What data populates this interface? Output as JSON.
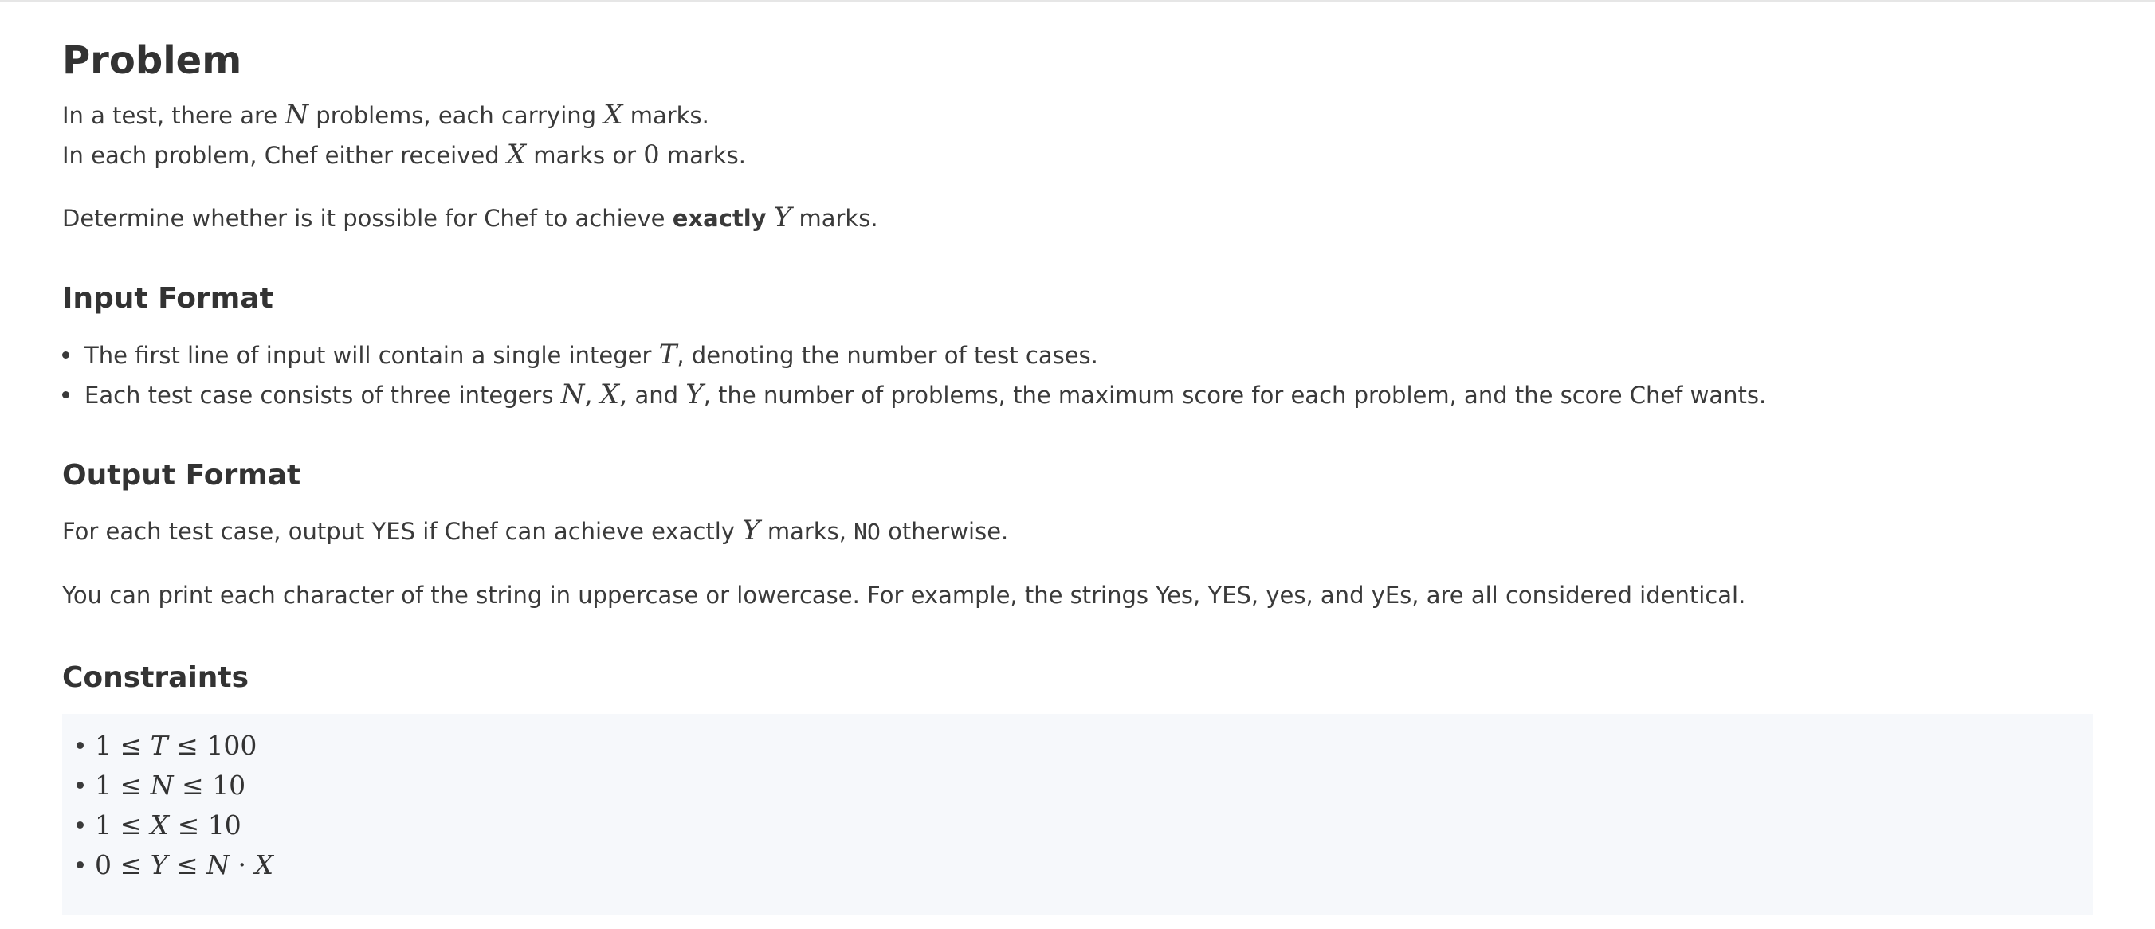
{
  "problem": {
    "title": "Problem",
    "l1_a": "In a test, there are ",
    "l1_var1": "N",
    "l1_b": " problems, each carrying ",
    "l1_var2": "X",
    "l1_c": " marks.",
    "l2_a": "In each problem, Chef either received ",
    "l2_var1": "X",
    "l2_b": " marks or ",
    "l2_num": "0",
    "l2_c": " marks.",
    "l3_a": "Determine whether is it possible for Chef to achieve ",
    "l3_bold": "exactly",
    "l3_var": "Y",
    "l3_b": " marks."
  },
  "input_format": {
    "title": "Input Format",
    "b1_a": "The first line of input will contain a single integer ",
    "b1_var": "T",
    "b1_b": ", denoting the number of test cases.",
    "b2_a": "Each test case consists of three integers ",
    "b2_var1": "N",
    "b2_var2": "X",
    "b2_and": " and ",
    "b2_var3": "Y",
    "b2_b": ", the number of problems, the maximum score for each problem, and the score Chef wants."
  },
  "output_format": {
    "title": "Output Format",
    "l1_a": "For each test case, output YES if Chef can achieve exactly ",
    "l1_var": "Y",
    "l1_b": " marks, ",
    "l1_code": "NO",
    "l1_c": " otherwise.",
    "l2": "You can print each character of the string in uppercase or lowercase. For example, the strings Yes, YES, yes, and yEs, are all considered identical."
  },
  "constraints": {
    "title": "Constraints",
    "items": [
      {
        "lhs": "1",
        "var": "T",
        "rhs": "100"
      },
      {
        "lhs": "1",
        "var": "N",
        "rhs": "10"
      },
      {
        "lhs": "1",
        "var": "X",
        "rhs": "10"
      },
      {
        "lhs": "0",
        "var": "Y",
        "rhs_var1": "N",
        "rhs_op": "·",
        "rhs_var2": "X"
      }
    ],
    "leq": "≤"
  }
}
